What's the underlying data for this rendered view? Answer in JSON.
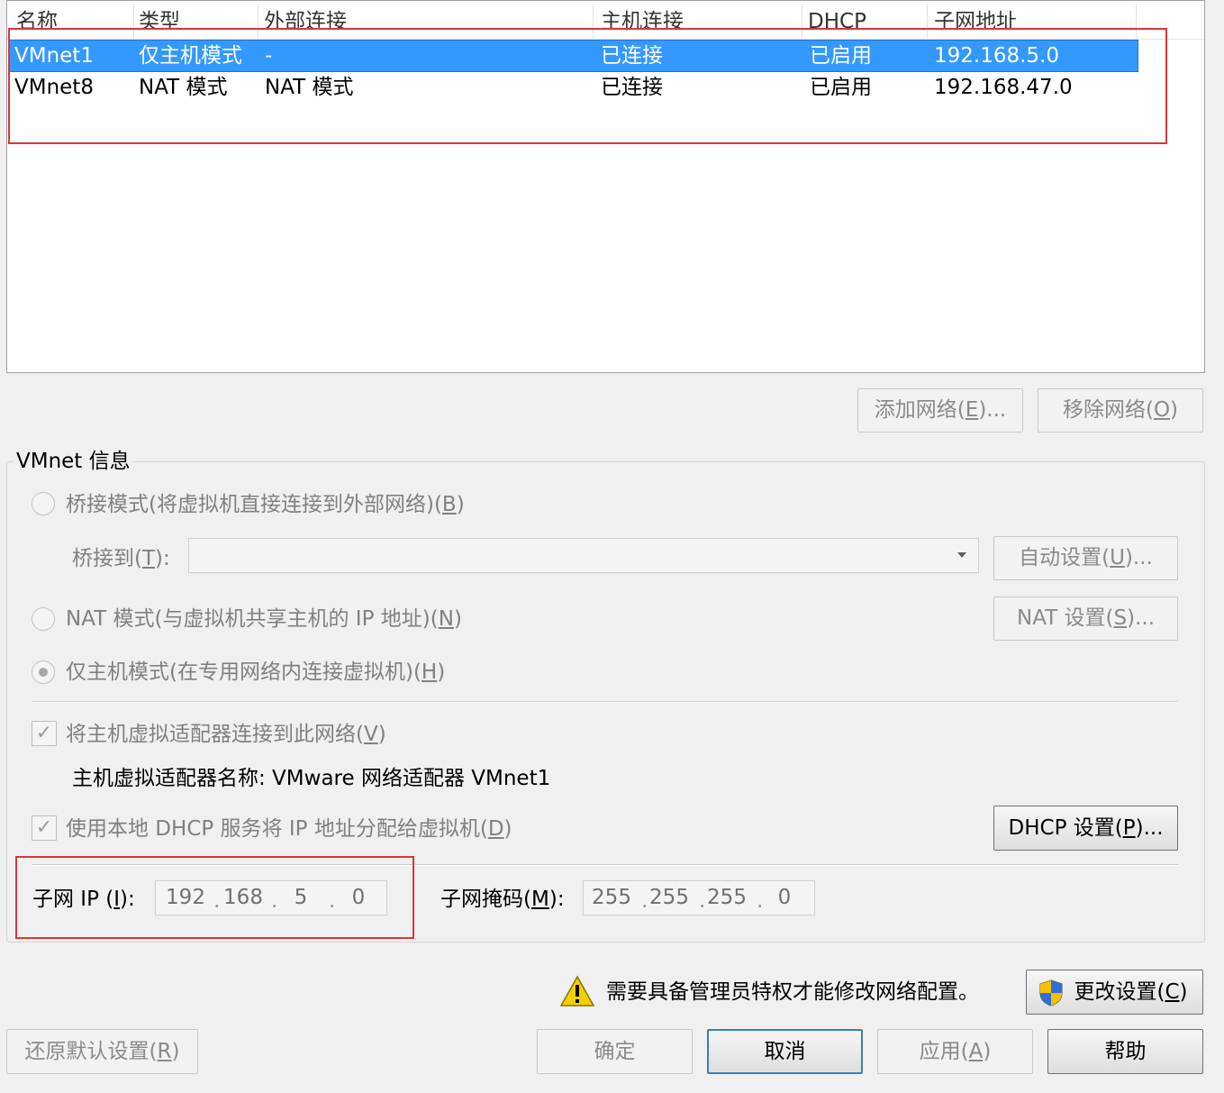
{
  "table": {
    "columns": [
      "名称",
      "类型",
      "外部连接",
      "主机连接",
      "DHCP",
      "子网地址"
    ],
    "rows": [
      {
        "name": "VMnet1",
        "type": "仅主机模式",
        "external": "-",
        "host": "已连接",
        "dhcp": "已启用",
        "subnet": "192.168.5.0",
        "selected": true
      },
      {
        "name": "VMnet8",
        "type": "NAT 模式",
        "external": "NAT 模式",
        "host": "已连接",
        "dhcp": "已启用",
        "subnet": "192.168.47.0",
        "selected": false
      }
    ]
  },
  "buttons": {
    "add_network": {
      "text": "添加网络(",
      "key": "E",
      "tail": ")..."
    },
    "remove_network": {
      "text": "移除网络(",
      "key": "O",
      "tail": ")"
    },
    "auto_settings": {
      "text": "自动设置(",
      "key": "U",
      "tail": ")..."
    },
    "nat_settings": {
      "text": "NAT 设置(",
      "key": "S",
      "tail": ")..."
    },
    "dhcp_settings": {
      "text": "DHCP 设置(",
      "key": "P",
      "tail": ")..."
    },
    "change_settings": {
      "text": "更改设置(",
      "key": "C",
      "tail": ")"
    },
    "restore_defaults": {
      "text": "还原默认设置(",
      "key": "R",
      "tail": ")"
    },
    "ok": "确定",
    "cancel": "取消",
    "apply": {
      "text": "应用(",
      "key": "A",
      "tail": ")"
    },
    "help": "帮助"
  },
  "vmnet_info": {
    "group_title": "VMnet 信息",
    "bridged": {
      "text": "桥接模式(将虚拟机直接连接到外部网络)(",
      "key": "B",
      "tail": ")"
    },
    "bridge_to": {
      "text": "桥接到(",
      "key": "T",
      "tail": "):"
    },
    "nat": {
      "text": "NAT 模式(与虚拟机共享主机的 IP 地址)(",
      "key": "N",
      "tail": ")"
    },
    "host_only": {
      "text": "仅主机模式(在专用网络内连接虚拟机)(",
      "key": "H",
      "tail": ")"
    },
    "selected_mode": "host_only",
    "connect_adapter": {
      "text": "将主机虚拟适配器连接到此网络(",
      "key": "V",
      "tail": ")",
      "checked": true
    },
    "adapter_name": "主机虚拟适配器名称: VMware 网络适配器 VMnet1",
    "use_dhcp": {
      "text": "使用本地 DHCP 服务将 IP 地址分配给虚拟机(",
      "key": "D",
      "tail": ")",
      "checked": true
    },
    "subnet_ip_label": {
      "text": "子网 IP (",
      "key": "I",
      "tail": "):"
    },
    "subnet_ip": [
      "192",
      "168",
      "5",
      "0"
    ],
    "subnet_mask_label": {
      "text": "子网掩码(",
      "key": "M",
      "tail": "):"
    },
    "subnet_mask": [
      "255",
      "255",
      "255",
      "0"
    ]
  },
  "warning": {
    "text": "需要具备管理员特权才能修改网络配置。"
  },
  "colors": {
    "selection": "#3399ff",
    "annotation_box": "#e0333a",
    "warning": "#f5d000"
  }
}
